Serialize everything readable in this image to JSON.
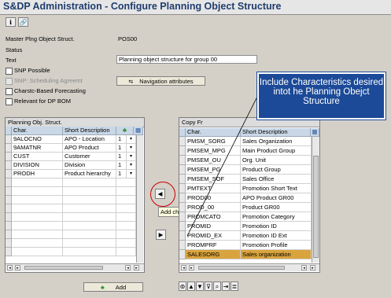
{
  "title": "S&DP Administration - Configure Planning Object Structure",
  "toolbar": {
    "btn1": "ℹ",
    "btn2": "🔗"
  },
  "form": {
    "master_label": "Master Plng Object Struct.",
    "master_value": "POS00",
    "status_label": "Status",
    "text_label": "Text",
    "text_value": "Planning object structure for group 00",
    "checks": [
      {
        "label": "SNP Possible",
        "enabled": true
      },
      {
        "label": "SNP: Scheduling Agreemt",
        "enabled": false
      },
      {
        "label": "Charstc-Based Forecasting",
        "enabled": true
      },
      {
        "label": "Relevant for DP BOM",
        "enabled": true
      }
    ],
    "nav_button": "Navigation attributes"
  },
  "left_grid": {
    "title": "Planning Obj. Struct.",
    "headers": [
      "Char.",
      "Short Description"
    ],
    "rows": [
      {
        "char": "9ALOCNO",
        "desc": "APO - Location",
        "num": "1"
      },
      {
        "char": "9AMATNR",
        "desc": "APO Product",
        "num": "1"
      },
      {
        "char": "CUST",
        "desc": "Customer",
        "num": "1"
      },
      {
        "char": "DIVISION",
        "desc": "Division",
        "num": "1"
      },
      {
        "char": "PRODH",
        "desc": "Product hierarchy",
        "num": "1"
      }
    ],
    "add_button": "Add"
  },
  "right_grid": {
    "title": "Copy Fr",
    "headers": [
      "Char.",
      "Short Description"
    ],
    "rows": [
      {
        "char": "PMSM_SORG",
        "desc": "Sales Organization"
      },
      {
        "char": "PMSEM_MPG",
        "desc": "Main Product Group"
      },
      {
        "char": "PMSEM_OU",
        "desc": "Org. Unit"
      },
      {
        "char": "PMSEM_PG",
        "desc": "Product Group"
      },
      {
        "char": "PMSEM_SOF",
        "desc": "Sales Office"
      },
      {
        "char": "PMTEXT",
        "desc": "Promotion Short Text"
      },
      {
        "char": "PROD00",
        "desc": "APO Product GR00"
      },
      {
        "char": "PROD_00",
        "desc": "Product GR00"
      },
      {
        "char": "PROMCATO",
        "desc": "Promotion Category"
      },
      {
        "char": "PROMID",
        "desc": "Promotion ID"
      },
      {
        "char": "PROMID_EX",
        "desc": "Promotion ID Ext"
      },
      {
        "char": "PROMPRF",
        "desc": "Promotion Profile"
      },
      {
        "char": "SALESORG",
        "desc": "Sales organization"
      }
    ],
    "highlight_index": 12
  },
  "transfer": {
    "left_arrow": "◀",
    "right_arrow": "▶",
    "tooltip": "Add char."
  },
  "callout": "Include Characteristics desired intot he Planning Obejct Structure",
  "colors": {
    "title": "#1f3d6e",
    "callout": "#1c4a98",
    "highlight": "#d9a43e",
    "red_circle": "#cc0000"
  }
}
